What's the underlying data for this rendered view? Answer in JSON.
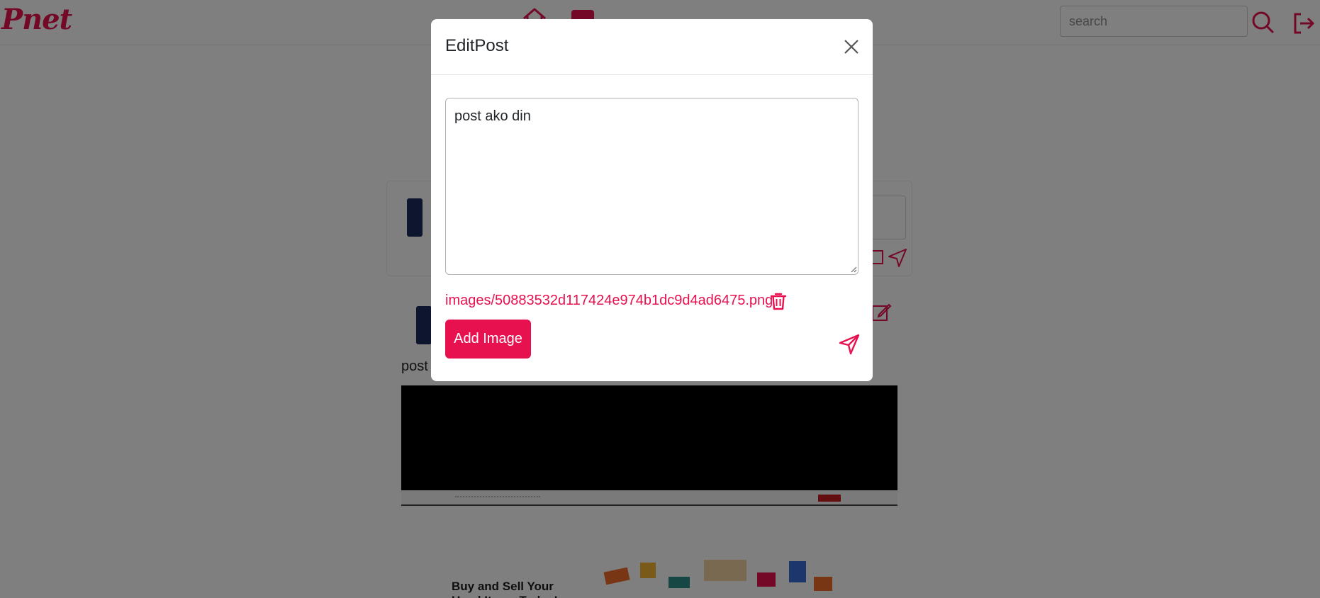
{
  "app": {
    "logo": "Pnet"
  },
  "search": {
    "placeholder": "search",
    "value": ""
  },
  "feed": {
    "post_text": "post",
    "ad": {
      "headline": "Buy and Sell Your Used Items Today!"
    }
  },
  "modal": {
    "title": "EditPost",
    "textarea_value": "post ako din",
    "image_path": "images/50883532d117424e974b1dc9d4ad6475.png",
    "add_image_label": "Add Image"
  },
  "colors": {
    "accent": "#e8114f",
    "overlay": "rgba(0,0,0,0.5)"
  },
  "icons": [
    "home-icon",
    "bell-icon",
    "search-icon",
    "logout-icon",
    "close-icon",
    "trash-icon",
    "send-icon",
    "image-icon",
    "edit-icon"
  ]
}
